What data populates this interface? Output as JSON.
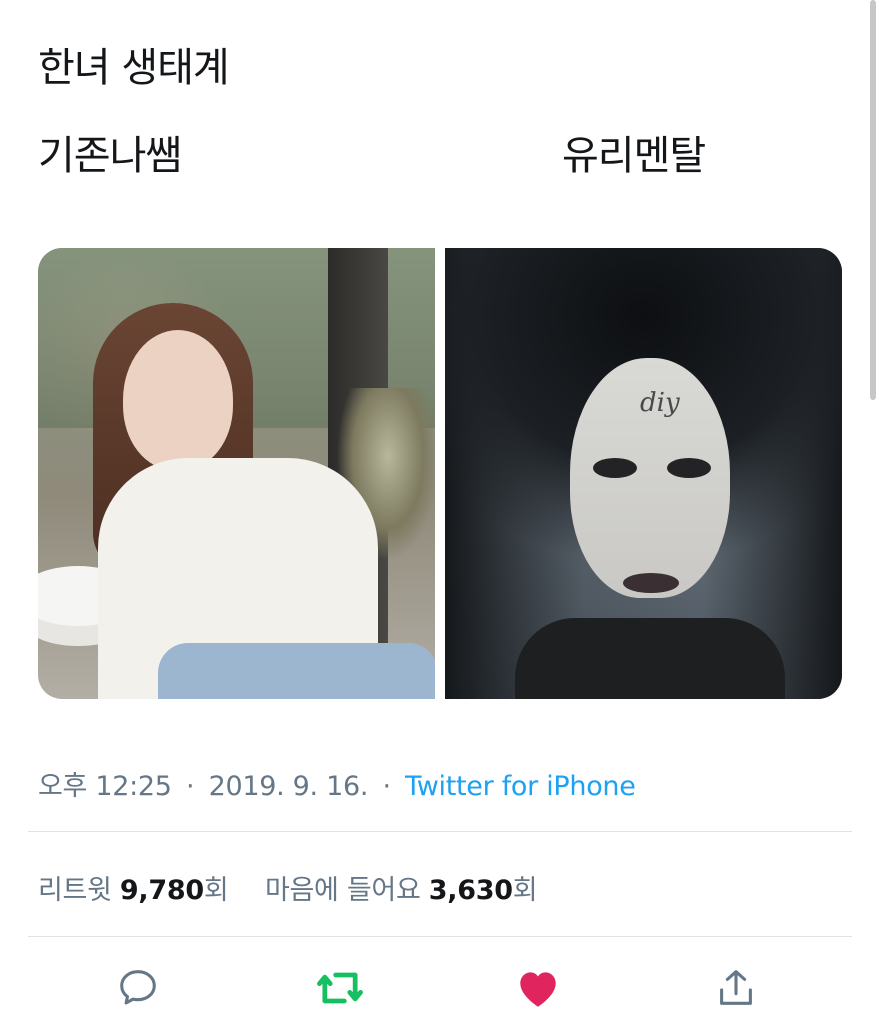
{
  "tweet": {
    "line1": "한녀 생태계",
    "left_label": "기존나쌤",
    "right_label": "유리멘탈"
  },
  "meta": {
    "time": "오후 12:25",
    "sep1": "·",
    "date": "2019. 9. 16.",
    "sep2": "·",
    "source": "Twitter for iPhone"
  },
  "stats": {
    "retweet_label": "리트윗",
    "retweet_count": "9,780",
    "retweet_unit": "회",
    "like_label": "마음에 들어요",
    "like_count": "3,630",
    "like_unit": "회"
  },
  "photos": {
    "right_forehead_text": "diy"
  },
  "actions": [
    {
      "name": "reply",
      "icon": "speech-bubble-icon",
      "color": "#657786"
    },
    {
      "name": "retweet",
      "icon": "retweet-icon",
      "color": "#17bf63"
    },
    {
      "name": "like",
      "icon": "heart-icon",
      "color": "#e0245e"
    },
    {
      "name": "share",
      "icon": "share-icon",
      "color": "#657786"
    }
  ],
  "colors": {
    "text": "#14171a",
    "muted": "#657786",
    "link": "#1da1f2",
    "retweet": "#17bf63",
    "like": "#e0245e"
  }
}
